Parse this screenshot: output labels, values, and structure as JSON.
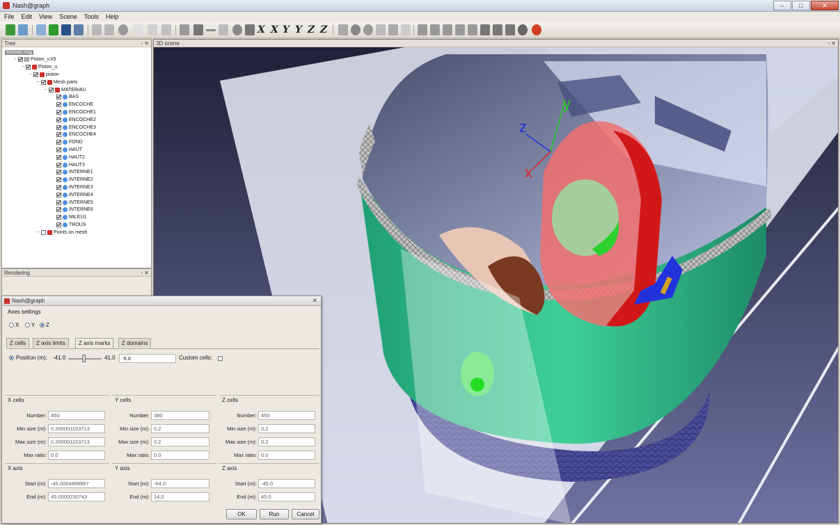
{
  "window": {
    "title": "Nash@graph"
  },
  "menu": [
    "File",
    "Edit",
    "View",
    "Scene",
    "Tools",
    "Help"
  ],
  "toolbar": {
    "axis_buttons": [
      "X",
      "X",
      "Y",
      "Y",
      "Z",
      "Z"
    ]
  },
  "tree_panel": {
    "title": "Tree",
    "items": [
      {
        "label": "session.nsg",
        "level": 0,
        "icon": "none",
        "checkbox": false,
        "selected": true
      },
      {
        "label": "Piston_u.k5",
        "level": 1,
        "icon": "grid",
        "checkbox": true,
        "selected": false
      },
      {
        "label": "Piston_u",
        "level": 2,
        "icon": "red",
        "checkbox": true,
        "selected": false
      },
      {
        "label": "piston",
        "level": 3,
        "icon": "red",
        "checkbox": true,
        "selected": false
      },
      {
        "label": "Mesh parts",
        "level": 4,
        "icon": "red",
        "checkbox": true,
        "selected": false
      },
      {
        "label": "MATERIAU",
        "level": 5,
        "icon": "red",
        "checkbox": true,
        "selected": false
      },
      {
        "label": "BAS",
        "level": 6,
        "icon": "blue",
        "checkbox": true,
        "selected": false
      },
      {
        "label": "ENCOCHE",
        "level": 6,
        "icon": "blue",
        "checkbox": true,
        "selected": false
      },
      {
        "label": "ENCOCHE1",
        "level": 6,
        "icon": "blue",
        "checkbox": true,
        "selected": false
      },
      {
        "label": "ENCOCHE2",
        "level": 6,
        "icon": "blue",
        "checkbox": true,
        "selected": false
      },
      {
        "label": "ENCOCHE3",
        "level": 6,
        "icon": "blue",
        "checkbox": true,
        "selected": false
      },
      {
        "label": "ENCOCHE4",
        "level": 6,
        "icon": "blue",
        "checkbox": true,
        "selected": false
      },
      {
        "label": "FOND",
        "level": 6,
        "icon": "blue",
        "checkbox": true,
        "selected": false
      },
      {
        "label": "HAUT",
        "level": 6,
        "icon": "blue",
        "checkbox": true,
        "selected": false
      },
      {
        "label": "HAUT2",
        "level": 6,
        "icon": "blue",
        "checkbox": true,
        "selected": false
      },
      {
        "label": "HAUT3",
        "level": 6,
        "icon": "blue",
        "checkbox": true,
        "selected": false
      },
      {
        "label": "INTERNE1",
        "level": 6,
        "icon": "blue",
        "checkbox": true,
        "selected": false
      },
      {
        "label": "INTERNE2",
        "level": 6,
        "icon": "blue",
        "checkbox": true,
        "selected": false
      },
      {
        "label": "INTERNE3",
        "level": 6,
        "icon": "blue",
        "checkbox": true,
        "selected": false
      },
      {
        "label": "INTERNE4",
        "level": 6,
        "icon": "blue",
        "checkbox": true,
        "selected": false
      },
      {
        "label": "INTERNE5",
        "level": 6,
        "icon": "blue",
        "checkbox": true,
        "selected": false
      },
      {
        "label": "INTERNE6",
        "level": 6,
        "icon": "blue",
        "checkbox": true,
        "selected": false
      },
      {
        "label": "MILEU1",
        "level": 6,
        "icon": "blue",
        "checkbox": true,
        "selected": false
      },
      {
        "label": "TROUS",
        "level": 6,
        "icon": "blue",
        "checkbox": true,
        "selected": false
      },
      {
        "label": "Points on mesh",
        "level": 4,
        "icon": "red",
        "checkbox": false,
        "selected": false
      }
    ]
  },
  "rendering_panel": {
    "title": "Rendering"
  },
  "scene_panel": {
    "title": "3D scene",
    "axis_labels": {
      "x": "x",
      "y": "y",
      "z": "z"
    }
  },
  "dialog": {
    "title": "Nash@graph",
    "axes_settings_label": "Axes settings",
    "axis_radio": [
      "X",
      "Y",
      "Z"
    ],
    "axis_radio_selected": "Z",
    "tabs": [
      "Z cells",
      "Z axis limits",
      "Z axis marks",
      "Z domains"
    ],
    "active_tab": "Z axis marks",
    "position_label": "Position (m):",
    "position_min": "-41.0",
    "position_max": "41.0",
    "position_value": "-5.0",
    "custom_cells_label": "Custom cells:",
    "x_cells": {
      "title": "X cells",
      "number_label": "Number:",
      "number": "450",
      "min_label": "Min size (m):",
      "min": "0.200001153713",
      "max_label": "Max size (m):",
      "max": "0.200001153713",
      "ratio_label": "Max ratio:",
      "ratio": "0.0"
    },
    "y_cells": {
      "title": "Y cells",
      "number_label": "Number:",
      "number": "390",
      "min_label": "Min size (m):",
      "min": "0.2",
      "max_label": "Max size (m):",
      "max": "0.2",
      "ratio_label": "Max ratio:",
      "ratio": "0.0"
    },
    "z_cells": {
      "title": "Z cells",
      "number_label": "Number:",
      "number": "450",
      "min_label": "Min size (m):",
      "min": "0.2",
      "max_label": "Max size (m):",
      "max": "0.2",
      "ratio_label": "Max ratio:",
      "ratio": "0.0"
    },
    "x_axis": {
      "title": "X axis",
      "start_label": "Start (m):",
      "start": "-45.0004968967",
      "end_label": "End (m):",
      "end": "45.0000230743"
    },
    "y_axis": {
      "title": "Y axis",
      "start_label": "Start (m):",
      "start": "-64.0",
      "end_label": "End (m):",
      "end": "14.0"
    },
    "z_axis": {
      "title": "Z axis",
      "start_label": "Start (m):",
      "start": "-45.0",
      "end_label": "End (m):",
      "end": "45.0"
    },
    "buttons": {
      "ok": "OK",
      "run": "Run",
      "cancel": "Cancel"
    }
  }
}
